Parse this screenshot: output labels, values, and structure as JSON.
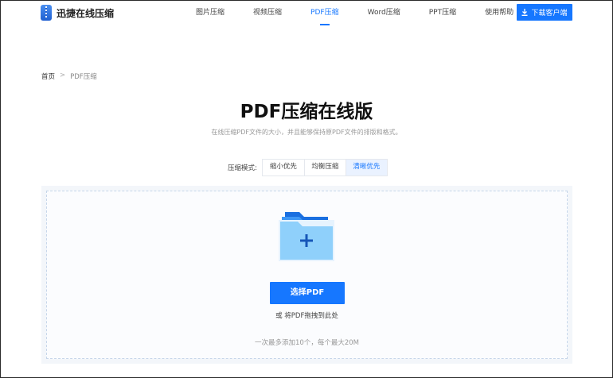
{
  "header": {
    "logo_text": "迅捷在线压缩",
    "nav": [
      {
        "label": "图片压缩",
        "active": false
      },
      {
        "label": "视频压缩",
        "active": false
      },
      {
        "label": "PDF压缩",
        "active": true
      },
      {
        "label": "Word压缩",
        "active": false
      },
      {
        "label": "PPT压缩",
        "active": false
      },
      {
        "label": "使用帮助",
        "active": false
      }
    ],
    "download_label": "下载客户端",
    "accent": "#1677ff"
  },
  "breadcrumb": {
    "home": "首页",
    "sep": ">",
    "current": "PDF压缩"
  },
  "main": {
    "title": "PDF压缩在线版",
    "subtitle": "在线压缩PDF文件的大小，并且能够保持原PDF文件的排版和格式。",
    "mode_label": "压缩模式:",
    "modes": [
      "缩小优先",
      "均衡压缩",
      "清晰优先"
    ],
    "selected_mode": "清晰优先"
  },
  "upload": {
    "button": "选择PDF",
    "drag_hint": "或 将PDF拖拽到此处",
    "limit": "一次最多添加10个，每个最大20M"
  }
}
